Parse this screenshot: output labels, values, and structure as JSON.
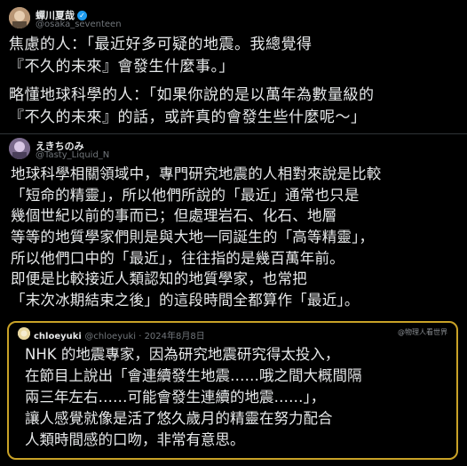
{
  "tweet1": {
    "name": "蟬川夏哉",
    "verified_icon": "verified-badge-icon",
    "handle": "@osaka_seventeen",
    "lines": [
      "焦慮的人：「最近好多可疑的地震。我總覺得",
      "『不久的未來』會發生什麼事。」",
      "略懂地球科學的人：「如果你說的是以萬年為數量級的",
      "『不久的未來』的話，或許真的會發生些什麼呢～」"
    ]
  },
  "tweet2": {
    "name": "えきちのみ",
    "handle": "@Tasty_Liquid_N",
    "lines": [
      "地球科學相關領域中，專門研究地震的人相對來說是比較",
      "「短命的精靈」，所以他們所說的「最近」通常也只是",
      "幾個世紀以前的事而已；但處理岩石、化石、地層",
      "等等的地質學家們則是與大地一同誕生的「高等精靈」，",
      "所以他們口中的「最近」，往往指的是幾百萬年前。",
      "即便是比較接近人類認知的地質學家，也常把",
      "「末次冰期結束之後」的這段時間全都算作「最近」。"
    ]
  },
  "quote": {
    "name": "chloeyuki",
    "handle_date": "@chloeyuki · 2024年8月8日",
    "watermark": "@物理人看世界",
    "lines": [
      "NHK 的地震專家，因為研究地震研究得太投入，",
      "在節目上說出「會連續發生地震……哦之間大概間隔",
      "兩三年左右……可能會發生連續的地震……」，",
      "讓人感覺就像是活了悠久歲月的精靈在努力配合",
      "人類時間感的口吻，非常有意思。"
    ]
  }
}
